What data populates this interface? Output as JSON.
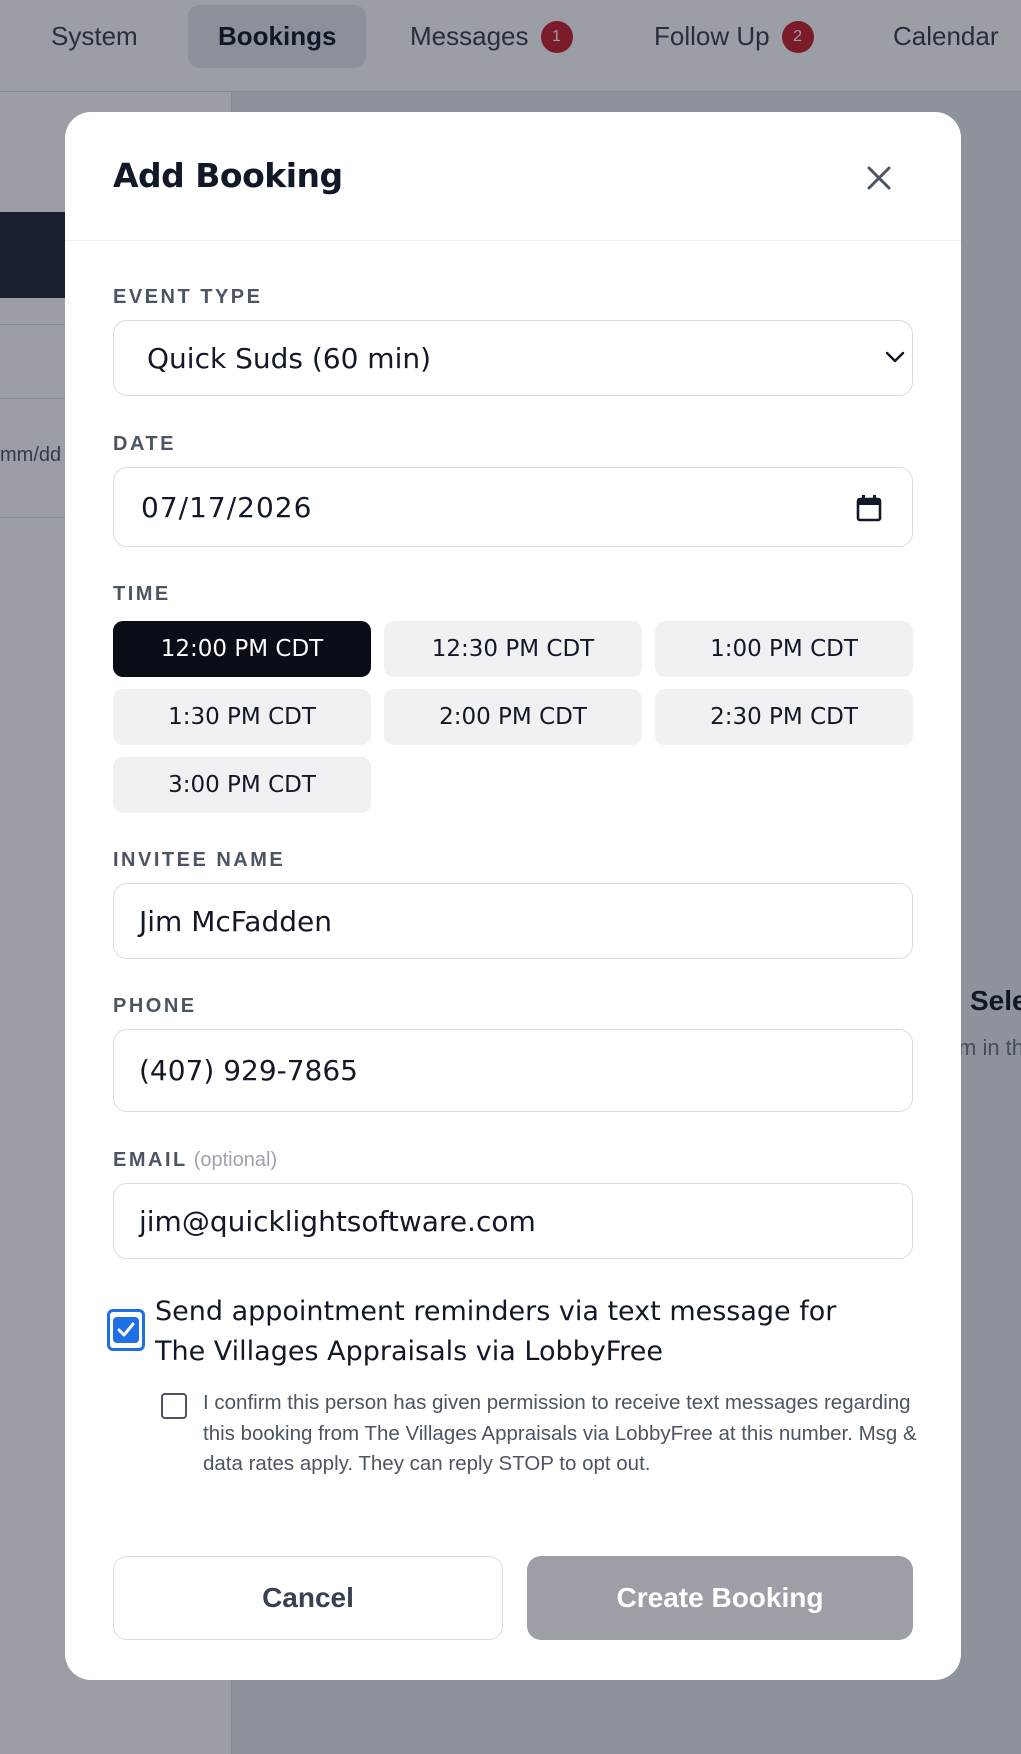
{
  "nav": {
    "tabs": [
      {
        "label": "System"
      },
      {
        "label": "Bookings",
        "active": true
      },
      {
        "label": "Messages",
        "badge": "1"
      },
      {
        "label": "Follow Up",
        "badge": "2"
      },
      {
        "label": "Calendar"
      }
    ]
  },
  "background": {
    "date_placeholder": "mm/dd",
    "panel_title": "Sele",
    "panel_subtitle": "m in th"
  },
  "modal": {
    "title": "Add Booking",
    "event_type": {
      "label": "EVENT TYPE",
      "value": "Quick Suds (60 min)"
    },
    "date": {
      "label": "DATE",
      "value": "07/17/2026"
    },
    "time": {
      "label": "TIME",
      "slots": [
        "12:00 PM CDT",
        "12:30 PM CDT",
        "1:00 PM CDT",
        "1:30 PM CDT",
        "2:00 PM CDT",
        "2:30 PM CDT",
        "3:00 PM CDT"
      ],
      "selected": "12:00 PM CDT"
    },
    "invitee": {
      "label": "INVITEE NAME",
      "value": "Jim McFadden"
    },
    "phone": {
      "label": "PHONE",
      "value": "(407) 929-7865"
    },
    "email": {
      "label": "EMAIL",
      "optional": "(optional)",
      "value": "jim@quicklightsoftware.com"
    },
    "sms_reminder": {
      "checked": true,
      "text": "Send appointment reminders via text message for The Villages Appraisals via LobbyFree"
    },
    "consent": {
      "checked": false,
      "text": "I confirm this person has given permission to receive text messages regarding this booking from The Villages Appraisals via LobbyFree at this number. Msg & data rates apply. They can reply STOP to opt out."
    },
    "buttons": {
      "cancel": "Cancel",
      "create": "Create Booking"
    }
  },
  "colors": {
    "accent_checkbox": "#1f6fe5",
    "selected_slot": "#080d16",
    "badge": "#c81e2e",
    "disabled_button": "#9ca0a6"
  }
}
